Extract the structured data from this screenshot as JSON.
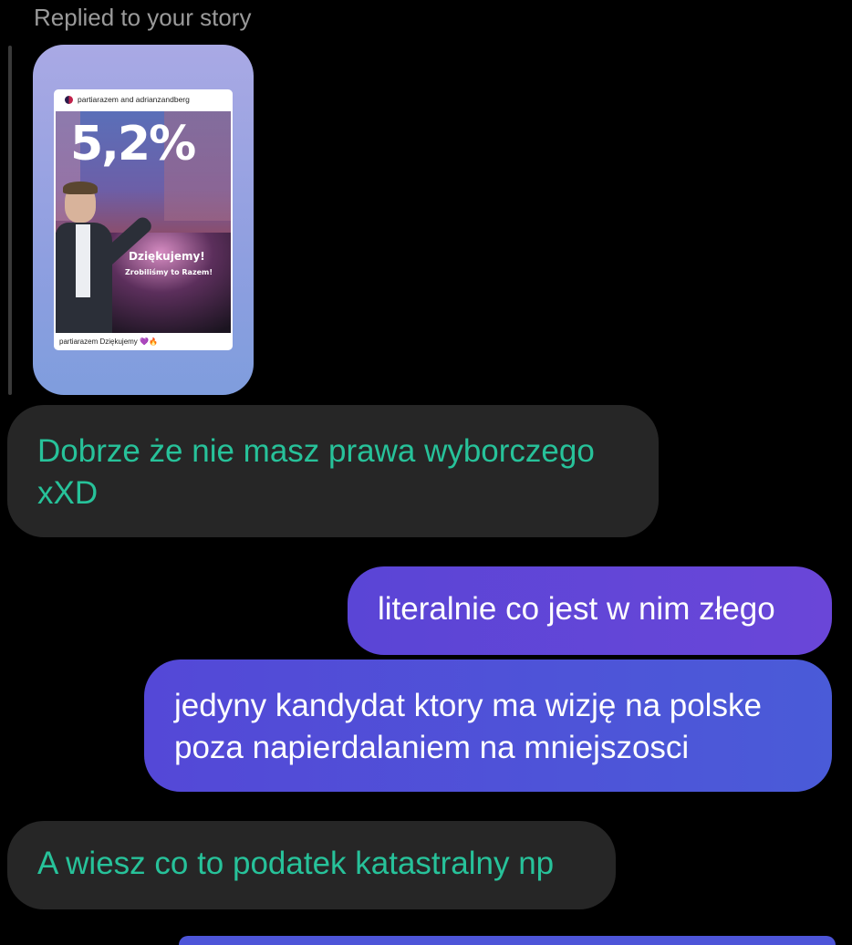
{
  "reply": {
    "label": "Replied to your story"
  },
  "story": {
    "header": "partiarazem and adrianzandberg",
    "big_text": "5,2%",
    "thanks": "Dziękujemy!",
    "together": "Zrobiliśmy to Razem!",
    "caption": "partiarazem Dziękujemy 💜🔥"
  },
  "messages": [
    {
      "direction": "incoming",
      "text": "Dobrze że nie masz prawa wyborczego xXD"
    },
    {
      "direction": "outgoing",
      "text": "literalnie co jest w nim złego"
    },
    {
      "direction": "outgoing",
      "text": "jedyny kandydat ktory ma wizję na polske poza napierdalaniem na mniejszosci"
    },
    {
      "direction": "incoming",
      "text": "A wiesz co to podatek katastralny np"
    }
  ],
  "colors": {
    "incoming_text": "#27c29a",
    "incoming_bg": "#262626",
    "outgoing_bg_start": "#5a45d6",
    "outgoing_bg_end": "#4a5bd8"
  }
}
